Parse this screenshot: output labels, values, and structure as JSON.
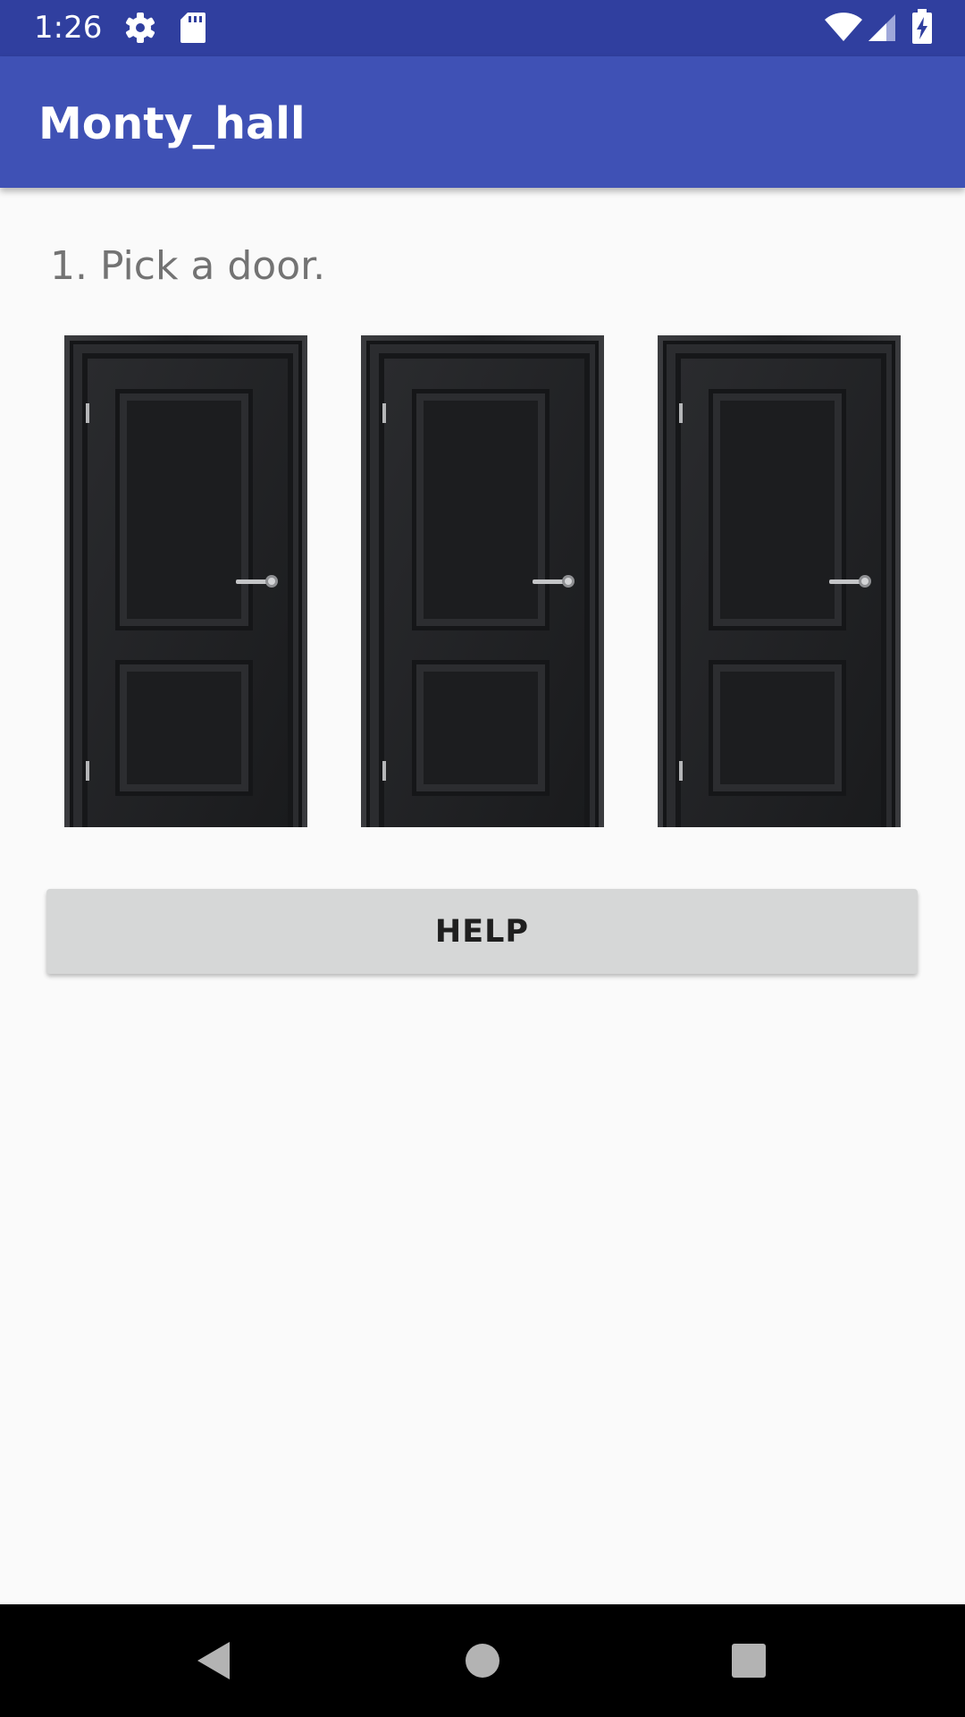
{
  "status_bar": {
    "time": "1:26",
    "icons": [
      "settings-icon",
      "sd-card-icon",
      "wifi-icon",
      "cell-signal-icon",
      "battery-charging-icon"
    ]
  },
  "app_bar": {
    "title": "Monty_hall"
  },
  "main": {
    "instruction": "1. Pick a door.",
    "doors": [
      {
        "icon": "door-icon"
      },
      {
        "icon": "door-icon"
      },
      {
        "icon": "door-icon"
      }
    ],
    "help_label": "HELP"
  },
  "nav_bar": {
    "icons": [
      "back-icon",
      "home-icon",
      "recents-icon"
    ]
  },
  "colors": {
    "status_bar": "#303f9f",
    "app_bar": "#3f51b5",
    "background": "#fafafa",
    "button": "#d6d7d7",
    "door": "#1e1f21"
  }
}
